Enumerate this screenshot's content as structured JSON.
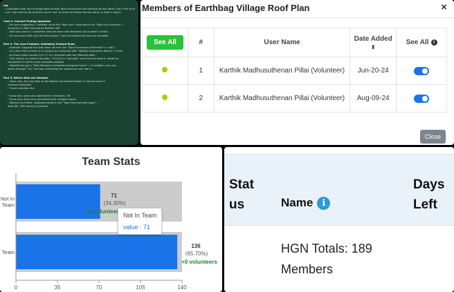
{
  "doc_panel": {
    "lines": [
      {
        "t": "ing.",
        "k": "h"
      },
      {
        "t": "...d standard what you're doing about finding Total Summaries and totaling the key items. Get a link to the",
        "k": ""
      },
      {
        "t": "...ces I use have by all correctly count \"use\" and use to finalize the key items, & total it clearly.",
        "k": ""
      },
      {
        "t": "",
        "k": ""
      },
      {
        "t": "Cont 1: Current Finding Appraisal",
        "k": "h"
      },
      {
        "t": "- For your suggestion, I consider value the \"Roof Sum\" total within the \"Total Org Summary\" ...",
        "k": "ind"
      },
      {
        "t": "  Summary in Total Summaries Refresh list?",
        "k": "ind"
      },
      {
        "t": "- Total only have a 1 volunteer who the team role attended, but it wasn't correct...",
        "k": "ind"
      },
      {
        "t": "- For one case (with only the best quote), I found the data that was not complete",
        "k": "ind"
      },
      {
        "t": "",
        "k": ""
      },
      {
        "t": "Part 2: The Core Problem: Validating Tracked Roles",
        "k": "h"
      },
      {
        "t": "- Example: Suppose the total team list from the \"Total Summaries Refreshed\" in a BC?",
        "k": "ind"
      },
      {
        "t": "- It is clear that no team is in need to be compared with \"Weekly Summaries Report\" in that...",
        "k": "ind"
      },
      {
        "t": "- As those report column in a \"x\" in a recorded with the effective date...",
        "k": "ind"
      },
      {
        "t": "- That means, to confirm the data, \"If find it in \"manually\" each time of team it, exists to...",
        "k": "ind"
      },
      {
        "t": "  somewhere in within to be revisable possibly.",
        "k": "ind"
      },
      {
        "t": "- Something's go in \"Total Members Completed Assigned Hours\" = In addition, you can...",
        "k": "ind"
      },
      {
        "t": "  would through \"121\" formula, something for reasons by one until is...",
        "k": "ind"
      },
      {
        "t": "",
        "k": ""
      },
      {
        "t": "Part 3: Where Dats Are Needed:",
        "k": "h"
      },
      {
        "t": "- Some new, the only filter to the Weekly Summaries Report is \"Active hours\"?",
        "k": "ind"
      },
      {
        "t": "  member assigned).",
        "k": "ind"
      },
      {
        "t": "- There's mention the",
        "k": "ind"
      },
      {
        "t": "",
        "k": ""
      },
      {
        "t": "* Show only users who submitted in members, OR",
        "k": "ind"
      },
      {
        "t": "* Show only users who completed their assigned hours",
        "k": "ind"
      },
      {
        "t": "- Without such filter, validating totals in the \"Total Org Summary page\"...",
        "k": "ind"
      },
      {
        "t": "  data (BC, HSE users) is involved",
        "k": "ind"
      }
    ]
  },
  "modal": {
    "title": "Members of Earthbag Village Roof Plan",
    "close_symbol": "×",
    "headers": {
      "see_all_button": "See All",
      "number": "#",
      "user_name": "User Name",
      "date_added": "Date Added",
      "sort_icon": "⬍",
      "see_all": "See All",
      "info_icon": "i"
    },
    "rows": [
      {
        "num": "1",
        "name": "Karthik Madhusuthenan Pillai (Volunteer)",
        "date": "Jun-20-24"
      },
      {
        "num": "2",
        "name": "Karthik Madhusuthenan Pillai (Volunteer)",
        "date": "Aug-09-24"
      }
    ],
    "status_color": "#9fd400",
    "toggle_color": "#1a73e8",
    "close_button": "Close"
  },
  "team_stats": {
    "title": "Team Stats",
    "tooltip": {
      "title": "Not In Team",
      "value": "value : 71"
    },
    "chart_data": {
      "type": "bar",
      "orientation": "horizontal",
      "categories": [
        "Not In Team",
        "In Team"
      ],
      "series": [
        {
          "values": [
            71,
            136
          ]
        }
      ],
      "max_values": [
        140,
        140
      ],
      "labels": [
        {
          "value": "71",
          "percent": "(34.30%)",
          "volunteers": "+0 volunteers"
        },
        {
          "value": "136",
          "percent": "(65.70%)",
          "volunteers": "+0 volunteers"
        }
      ],
      "visible_category_labels": [
        "Not In\nTeam",
        "Team"
      ],
      "x_ticks": [
        0,
        35,
        70,
        105,
        140
      ],
      "xlim": [
        0,
        140
      ],
      "colors": {
        "bar": "#1a73e8",
        "track": "#cccccc",
        "label": "#333333",
        "volunteers": "#1e7e34"
      }
    }
  },
  "members_table": {
    "status_header": "Stat us",
    "name_header": "Name",
    "info_icon": "i",
    "days_header": "Days Left",
    "totals_text": "HGN Totals: 189 Members"
  }
}
